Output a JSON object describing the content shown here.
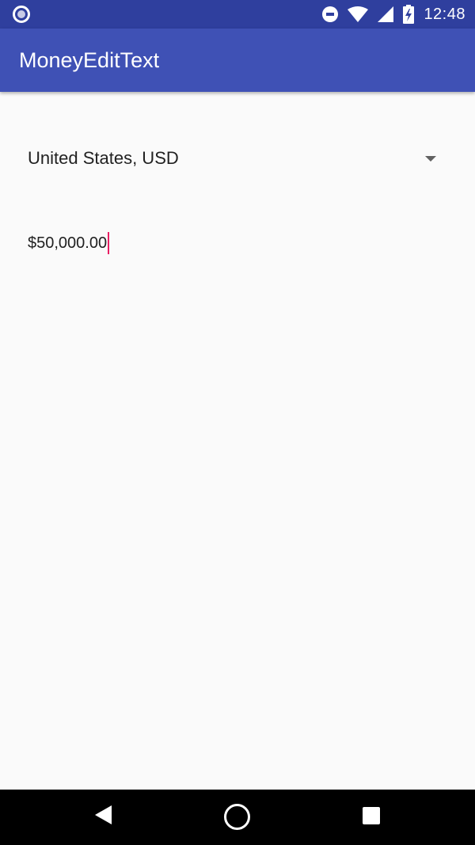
{
  "status_bar": {
    "time": "12:48",
    "icons": [
      "notification-icon",
      "do-not-disturb-icon",
      "wifi-icon",
      "signal-icon",
      "battery-charging-icon"
    ]
  },
  "app_bar": {
    "title": "MoneyEditText"
  },
  "currency_spinner": {
    "selected": "United States, USD",
    "icon": "dropdown-arrow-icon"
  },
  "money_input": {
    "value": "$50,000.00"
  },
  "nav_bar": {
    "icons": [
      "back-icon",
      "home-icon",
      "recents-icon"
    ]
  },
  "colors": {
    "primary": "#3f51b5",
    "primary_dark": "#2f3f9e",
    "accent": "#e91e63",
    "background": "#fafafa"
  }
}
